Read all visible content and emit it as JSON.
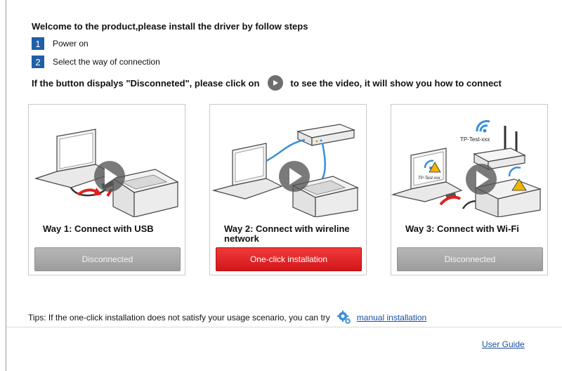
{
  "welcome": "Welcome to the product,please install the driver by follow steps",
  "steps": [
    {
      "num": "1",
      "label": "Power on"
    },
    {
      "num": "2",
      "label": "Select the way of connection"
    }
  ],
  "hint": {
    "before": "If the button dispalys \"Disconneted\", please click on",
    "after": "to see the video, it will show you how to connect",
    "icon": "play-icon"
  },
  "cards": [
    {
      "title": "Way 1: Connect with USB",
      "button": "Disconnected",
      "state": "disabled"
    },
    {
      "title": "Way 2: Connect with wireline network",
      "button": "One-click installation",
      "state": "active"
    },
    {
      "title": "Way 3: Connect with Wi-Fi",
      "button": "Disconnected",
      "state": "disabled",
      "ssid": "TP-Test-xxx"
    }
  ],
  "tips": {
    "text": "Tips: If the one-click installation does not satisfy your usage scenario, you can try",
    "link": "manual installation",
    "icon": "gear-icon"
  },
  "footer": {
    "user_guide": "User Guide"
  },
  "colors": {
    "accent_blue": "#1f5fa8",
    "primary_red": "#d4161b",
    "disabled_grey": "#a8a8a8",
    "link": "#1a4fa0"
  }
}
